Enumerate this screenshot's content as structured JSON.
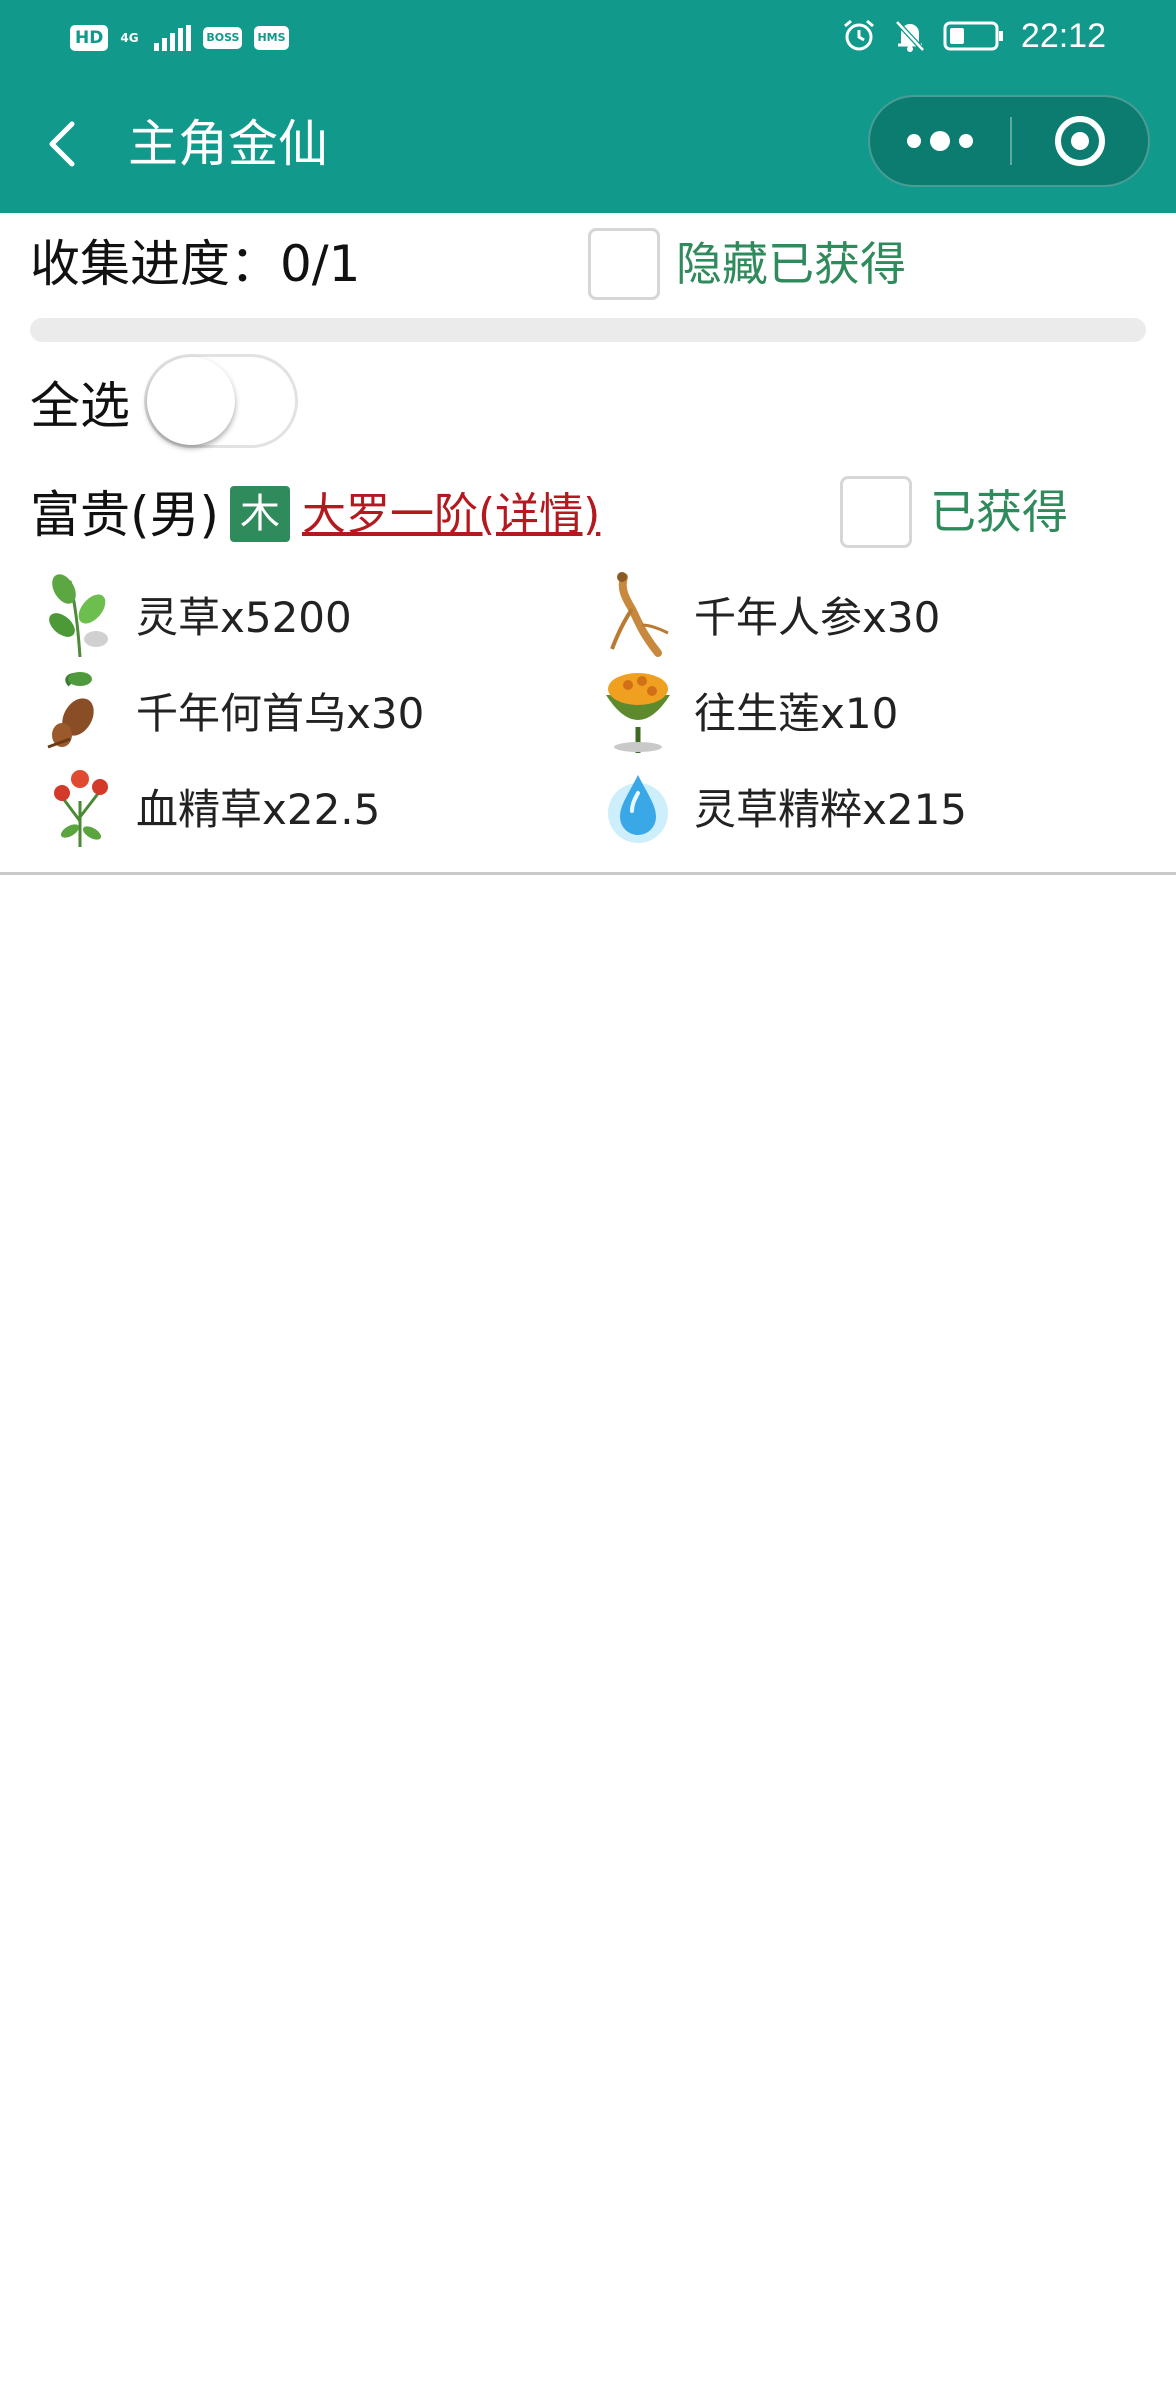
{
  "status_bar": {
    "hd_badge": "HD",
    "network": "4G",
    "boss_badge": "BOSS",
    "hms_badge": "HMS",
    "time": "22:12",
    "icons": [
      "alarm-icon",
      "bell-off-icon",
      "battery-icon"
    ]
  },
  "nav": {
    "title": "主角金仙",
    "back_icon": "chevron-left-icon",
    "more_icon": "more-dots-icon",
    "close_icon": "target-close-icon"
  },
  "collection": {
    "progress_text": "收集进度：0/1",
    "progress_fraction": 0,
    "hide_obtained_label": "隐藏已获得",
    "hide_obtained_checked": false
  },
  "select_all": {
    "label": "全选",
    "on": false
  },
  "item": {
    "name": "富贵(男)",
    "element": "木",
    "element_color": "#2f8a5c",
    "detail_link": "大罗一阶(详情)",
    "detail_color": "#b3191f",
    "obtained_label": "已获得",
    "obtained_checked": false,
    "materials": [
      {
        "label": "灵草x5200",
        "icon": "spirit-herb-icon"
      },
      {
        "label": "千年人参x30",
        "icon": "ginseng-icon"
      },
      {
        "label": "千年何首乌x30",
        "icon": "heshouwu-root-icon"
      },
      {
        "label": "往生莲x10",
        "icon": "rebirth-lotus-icon"
      },
      {
        "label": "血精草x22.5",
        "icon": "blood-herb-icon"
      },
      {
        "label": "灵草精粹x215",
        "icon": "herb-essence-icon"
      }
    ]
  },
  "colors": {
    "header": "#11998c",
    "accent_green": "#2f8a5c"
  }
}
